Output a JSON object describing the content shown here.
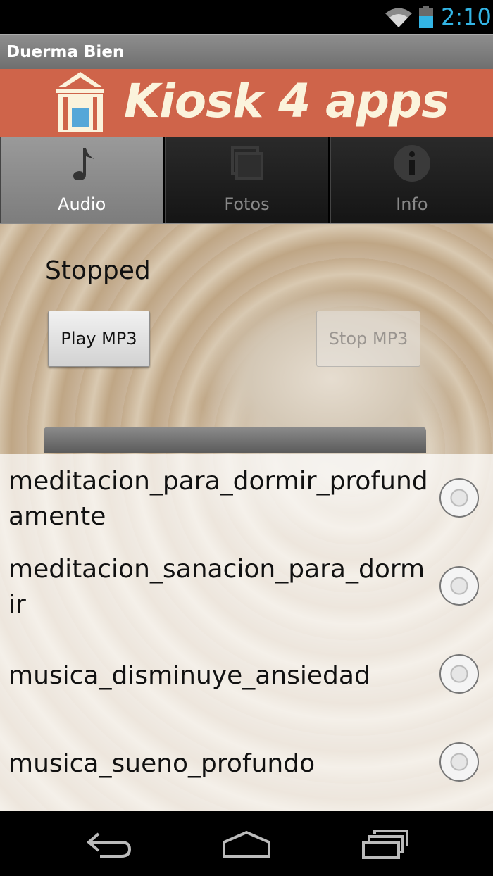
{
  "status_bar": {
    "time": "2:10",
    "icons": [
      "wifi-icon",
      "battery-icon"
    ],
    "accent": "#33b5e5"
  },
  "app_title": "Duerma Bien",
  "banner": {
    "brand": "Kiosk 4 apps",
    "background": "#cf644a"
  },
  "tabs": [
    {
      "label": "Audio",
      "icon": "music-note-icon",
      "active": true
    },
    {
      "label": "Fotos",
      "icon": "photos-icon",
      "active": false
    },
    {
      "label": "Info",
      "icon": "info-icon",
      "active": false
    }
  ],
  "player": {
    "status": "Stopped",
    "play_label": "Play MP3",
    "stop_label": "Stop MP3",
    "stop_enabled": false
  },
  "tracks": [
    {
      "label": "meditacion_para_dormir_profundamente",
      "selected": false
    },
    {
      "label": "meditacion_sanacion_para_dormir",
      "selected": false
    },
    {
      "label": "musica_disminuye_ansiedad",
      "selected": false
    },
    {
      "label": "musica_sueno_profundo",
      "selected": false
    }
  ],
  "nav": [
    "back-icon",
    "home-icon",
    "recents-icon"
  ]
}
